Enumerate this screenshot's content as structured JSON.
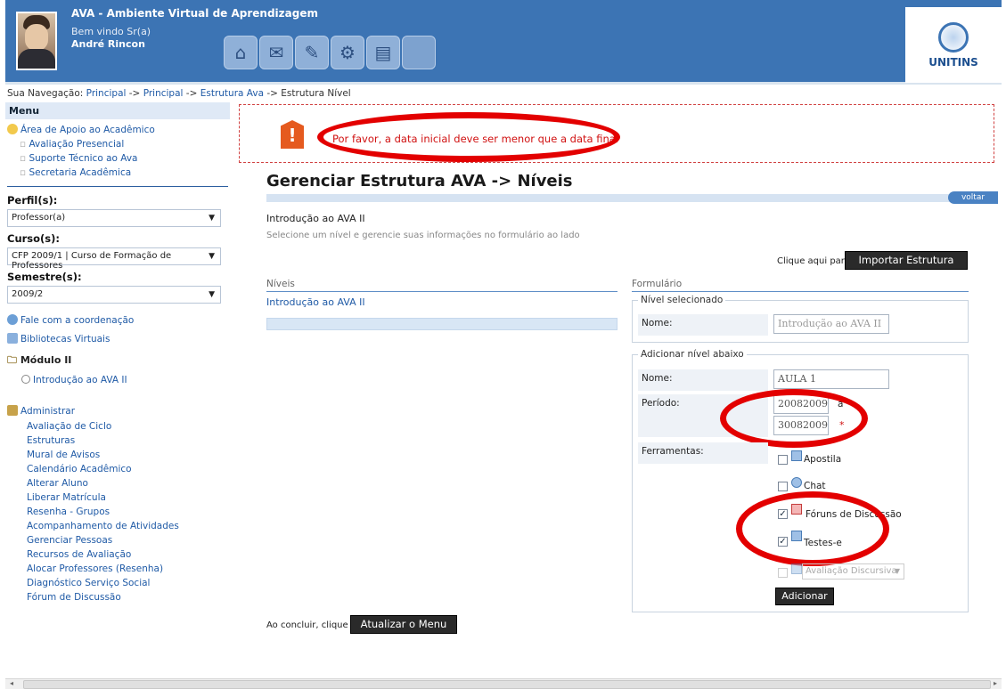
{
  "header": {
    "app_title": "AVA - Ambiente Virtual de Aprendizagem",
    "welcome": "Bem vindo Sr(a)",
    "user_name": "André Rincon",
    "logo_text": "UNITINS",
    "toolbar_icons": [
      "home-icon",
      "email-icon",
      "tools-icon",
      "settings-icon",
      "books-icon",
      "blank-icon"
    ]
  },
  "breadcrumb": {
    "prefix": "Sua Navegação:",
    "items": [
      "Principal",
      "Principal",
      "Estrutura Ava"
    ],
    "separator": "->",
    "current": "Estrutura Nível"
  },
  "sidebar": {
    "menu_title": "Menu",
    "support_title": "Área de Apoio ao Acadêmico",
    "support_items": [
      "Avaliação Presencial",
      "Suporte Técnico ao Ava",
      "Secretaria Acadêmica"
    ],
    "profile_label": "Perfil(s):",
    "profile_value": "Professor(a)",
    "course_label": "Curso(s):",
    "course_value": "CFP 2009/1 | Curso de Formação de Professores",
    "semester_label": "Semestre(s):",
    "semester_value": "2009/2",
    "contact_link": "Fale com a coordenação",
    "library_link": "Bibliotecas Virtuais",
    "module_title": "Módulo II",
    "module_item": "Introdução ao AVA II",
    "admin_title": "Administrar",
    "admin_items": [
      "Avaliação de Ciclo",
      "Estruturas",
      "Mural de Avisos",
      "Calendário Acadêmico",
      "Alterar Aluno",
      "Liberar Matrícula",
      "Resenha - Grupos",
      "Acompanhamento de Atividades",
      "Gerenciar Pessoas",
      "Recursos de Avaliação",
      "Alocar Professores (Resenha)",
      "Diagnóstico Serviço Social",
      "Fórum de Discussão"
    ]
  },
  "main": {
    "alert_message": "Por favor, a data inicial deve ser menor que a data final",
    "page_title": "Gerenciar Estrutura AVA -> Níveis",
    "back_label": "voltar",
    "course_name": "Introdução ao AVA II",
    "hint": "Selecione um nível e gerencie suas informações no formulário ao lado",
    "import_prompt": "Clique aqui para",
    "import_button": "Importar Estrutura",
    "levels_header": "Níveis",
    "level_item": "Introdução ao AVA II",
    "form_header": "Formulário",
    "selected_legend": "Nível selecionado",
    "name_label": "Nome:",
    "selected_name": "Introdução ao AVA II",
    "add_legend": "Adicionar nível abaixo",
    "add_name_value": "AULA 1",
    "period_label": "Período:",
    "period_start": "20082009",
    "period_to": "a",
    "period_end": "30082009",
    "required_mark": "*",
    "tools_label": "Ferramentas:",
    "tools": [
      {
        "label": "Apostila",
        "checked": false
      },
      {
        "label": "Chat",
        "checked": false
      },
      {
        "label": "Fóruns de Discussão",
        "checked": true
      },
      {
        "label": "Testes-e",
        "checked": true
      }
    ],
    "discursive_select": "Avaliação Discursiva",
    "add_button": "Adicionar",
    "finish_prompt": "Ao concluir, clique para",
    "update_button": "Atualizar o Menu"
  },
  "colors": {
    "header_bg": "#3c74b4",
    "alert_red": "#d01010",
    "highlight_oval": "#e30000",
    "link": "#1f5aa6"
  }
}
